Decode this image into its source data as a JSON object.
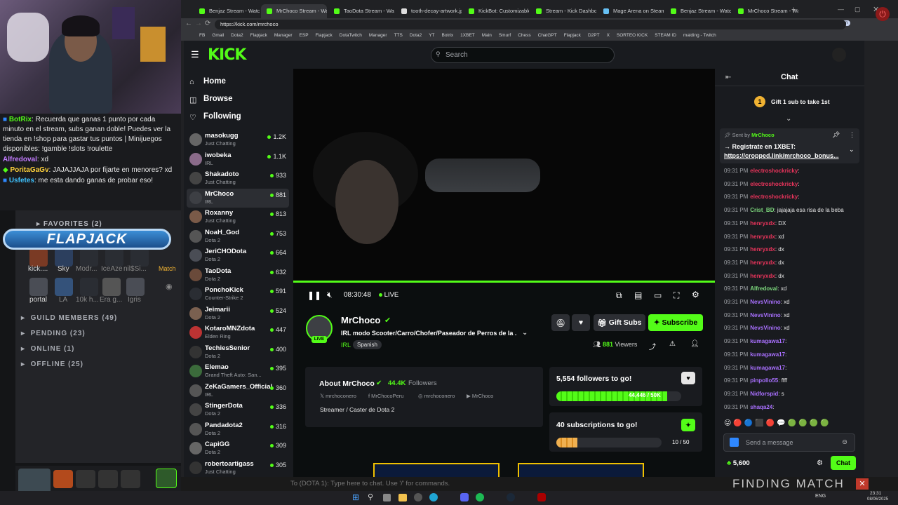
{
  "colors": {
    "accent": "#53fc18",
    "red_user": "#e8345b",
    "green_user": "#7dd87d",
    "purple_user": "#a970ff"
  },
  "overlay": {
    "chat_lines": [
      {
        "user": "BotRix",
        "text": ": Recuerda que ganas 1 punto por cada minuto en el stream, subs ganan doble! Puedes ver la tienda en !shop para gastar tus puntos | Minijuegos disponibles: !gamble !slots !roulette"
      },
      {
        "user": "Alfredoval",
        "text": ": xd"
      },
      {
        "user": "PoritaGaGv",
        "text": ": JAJAJJAJA por fijarte en menores? xd"
      },
      {
        "user": "Usfetes",
        "text": ": me esta dando ganas de probar eso!"
      }
    ],
    "flapjack": "FLAPJACK",
    "discord": {
      "favorites": "FAVORITES (2)",
      "game_labels": [
        "kick....",
        "Sky",
        "Modr...",
        "IceAze",
        "nil$Si..."
      ],
      "match": "Match",
      "row2": [
        "portal",
        "LA",
        "10k h...",
        "Era g...",
        "Igris"
      ],
      "guild_members": "GUILD MEMBERS (49)",
      "pending": "PENDING (23)",
      "online": "ONLINE (1)",
      "offline": "OFFLINE (25)"
    }
  },
  "browser": {
    "tabs": [
      "Benjaz Stream - Watch",
      "MrChoco Stream - Wat",
      "TaoDota Stream - Wat",
      "tooth-decay-artwork.jp",
      "KickBot: Customizable",
      "Stream - Kick Dashboa",
      "Mage Arena on Steam",
      "Benjaz Stream - Watch",
      "MrChoco Stream - Wat"
    ],
    "url": "https://kick.com/mrchoco",
    "bookmarks": [
      "FB",
      "Gmail",
      "Dota2",
      "Flapjack",
      "Manager",
      "ESP",
      "Flapjack",
      "DotaTwitch",
      "Manager",
      "TTS",
      "Dota2",
      "YT",
      "Botrix",
      "1XBET",
      "Main",
      "Smurf",
      "Chess",
      "ChatGPT",
      "Flapjack",
      "D2PT",
      "X",
      "SORTEO KICK",
      "STEAM ID",
      "malding - Twitch"
    ]
  },
  "kick": {
    "logo": "KICK",
    "search_placeholder": "Search",
    "nav": {
      "home": "Home",
      "browse": "Browse",
      "following": "Following"
    },
    "channels": [
      {
        "name": "masokugg",
        "cat": "Just Chatting",
        "viewers": "1.2K"
      },
      {
        "name": "iwobeka",
        "cat": "IRL",
        "viewers": "1.1K"
      },
      {
        "name": "Shakadoto",
        "cat": "Just Chatting",
        "viewers": "933"
      },
      {
        "name": "MrChoco",
        "cat": "IRL",
        "viewers": "881"
      },
      {
        "name": "Roxanny",
        "cat": "Just Chatting",
        "viewers": "813"
      },
      {
        "name": "NoaH_God",
        "cat": "Dota 2",
        "viewers": "753"
      },
      {
        "name": "JeriCHODota",
        "cat": "Dota 2",
        "viewers": "664"
      },
      {
        "name": "TaoDota",
        "cat": "Dota 2",
        "viewers": "632"
      },
      {
        "name": "PonchoKick",
        "cat": "Counter-Strike 2",
        "viewers": "591"
      },
      {
        "name": "Jeimarii",
        "cat": "Dota 2",
        "viewers": "524"
      },
      {
        "name": "KotaroMNZdota",
        "cat": "Elden Ring",
        "viewers": "447"
      },
      {
        "name": "TechiesSenior",
        "cat": "Dota 2",
        "viewers": "400"
      },
      {
        "name": "Elemao",
        "cat": "Grand Theft Auto: San...",
        "viewers": "395"
      },
      {
        "name": "ZeKaGamers_Official",
        "cat": "IRL",
        "viewers": "360"
      },
      {
        "name": "StingerDota",
        "cat": "Dota 2",
        "viewers": "336"
      },
      {
        "name": "Pandadota2",
        "cat": "Dota 2",
        "viewers": "316"
      },
      {
        "name": "CapiGG",
        "cat": "Dota 2",
        "viewers": "309"
      },
      {
        "name": "robertoartigass",
        "cat": "Just Chatting",
        "viewers": "305"
      }
    ],
    "player": {
      "time": "08:30:48",
      "live": "LIVE"
    },
    "stream": {
      "name": "MrChoco",
      "title": "IRL modo Scooter/Carro/Chofer/Paseador de Perros de la ...",
      "category": "IRL",
      "tag": "Spanish",
      "live_badge": "LIVE",
      "viewers": "881",
      "viewers_label": "Viewers",
      "gift_subs": "Gift Subs",
      "subscribe": "Subscribe"
    },
    "about": {
      "title": "About MrChoco",
      "followers": "44.4K",
      "followers_label": "Followers",
      "socials": [
        "mrchoconero",
        "MrChocoPeru",
        "mrchoconero",
        "MrChoco"
      ],
      "bio": "Streamer / Caster de Dota 2"
    },
    "goals": {
      "followers_title": "5,554 followers to go!",
      "followers_progress": "44,446 / 50K",
      "followers_fraction": 0.889,
      "subs_title": "40 subscriptions to go!",
      "subs_progress": "10 / 50",
      "subs_fraction": 0.2
    },
    "chat": {
      "title": "Chat",
      "gift": "Gift 1 sub to take 1st",
      "gift_count": "1",
      "pinned_by": "Sent by",
      "pinned_user": "MrChoco",
      "pinned_text": "→ Registrate en 1XBET:",
      "pinned_link": "https://cropped.link/mrchoco_bonus...",
      "messages": [
        {
          "t": "09:31 PM",
          "u": "electroshockricky",
          "m": ":",
          "c": "#e8345b"
        },
        {
          "t": "09:31 PM",
          "u": "electroshockricky",
          "m": ":",
          "c": "#e8345b"
        },
        {
          "t": "09:31 PM",
          "u": "electroshockricky",
          "m": ":",
          "c": "#e8345b"
        },
        {
          "t": "09:31 PM",
          "u": "Crist_BD",
          "m": ": jajajaja esa risa de la beba",
          "c": "#7dd87d"
        },
        {
          "t": "09:31 PM",
          "u": "henryxdx",
          "m": ": DX",
          "c": "#e8345b"
        },
        {
          "t": "09:31 PM",
          "u": "henryxdx",
          "m": ": xd",
          "c": "#e8345b"
        },
        {
          "t": "09:31 PM",
          "u": "henryxdx",
          "m": ": dx",
          "c": "#e8345b"
        },
        {
          "t": "09:31 PM",
          "u": "henryxdx",
          "m": ": dx",
          "c": "#e8345b"
        },
        {
          "t": "09:31 PM",
          "u": "henryxdx",
          "m": ": dx",
          "c": "#e8345b"
        },
        {
          "t": "09:31 PM",
          "u": "Alfredoval",
          "m": ": xd",
          "c": "#7dd87d"
        },
        {
          "t": "09:31 PM",
          "u": "NevsVinino",
          "m": ": xd",
          "c": "#a970ff"
        },
        {
          "t": "09:31 PM",
          "u": "NevsVinino",
          "m": ": xd",
          "c": "#a970ff"
        },
        {
          "t": "09:31 PM",
          "u": "NevsVinino",
          "m": ": xd",
          "c": "#a970ff"
        },
        {
          "t": "09:31 PM",
          "u": "kumagawa17",
          "m": ":",
          "c": "#a970ff"
        },
        {
          "t": "09:31 PM",
          "u": "kumagawa17",
          "m": ":",
          "c": "#a970ff"
        },
        {
          "t": "09:31 PM",
          "u": "kumagawa17",
          "m": ":",
          "c": "#a970ff"
        },
        {
          "t": "09:31 PM",
          "u": "pinpollo55",
          "m": ": ffff",
          "c": "#a970ff"
        },
        {
          "t": "09:31 PM",
          "u": "Nidforspid",
          "m": ": s",
          "c": "#a970ff"
        },
        {
          "t": "09:31 PM",
          "u": "shaqa24",
          "m": ":",
          "c": "#a970ff"
        }
      ],
      "input_placeholder": "Send a message",
      "points": "5,600",
      "send": "Chat"
    }
  },
  "game": {
    "chat_hint": "To (DOTA 1):  Type here to chat. Use '/' for commands.",
    "finding": "FINDING MATCH"
  },
  "taskbar": {
    "time": "23:31",
    "date": "08/06/2025",
    "lang": "ENG"
  }
}
